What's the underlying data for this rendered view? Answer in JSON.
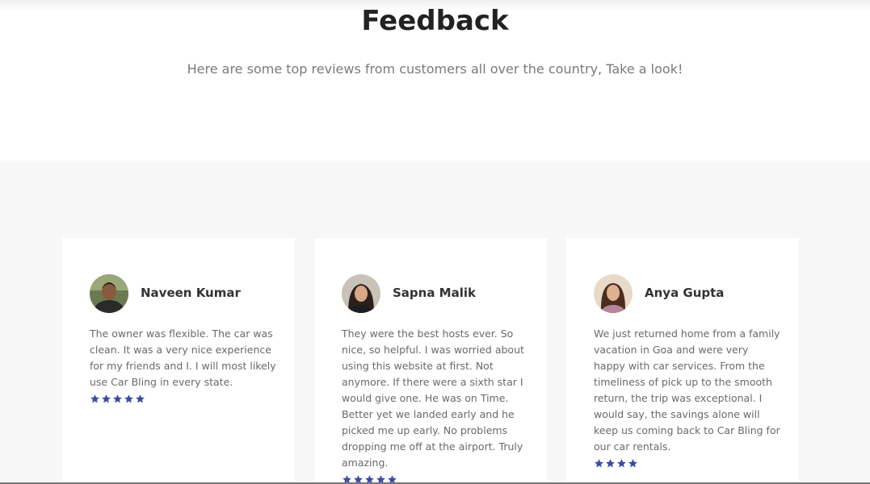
{
  "section": {
    "title": "Feedback",
    "subtitle": "Here are some top reviews from customers all over the country, Take a look!"
  },
  "colors": {
    "star": "#3b4ba8",
    "background_gray": "#f7f7f7"
  },
  "reviews": [
    {
      "name": "Naveen Kumar",
      "text": "The owner was flexible. The car was clean. It was a very nice experience for my friends and I. I will most likely use Car Bling in every state.",
      "rating": 5
    },
    {
      "name": "Sapna Malik",
      "text": "They were the best hosts ever. So nice, so helpful. I was worried about using this website at first. Not anymore. If there were a sixth star I would give one. He was on Time. Better yet we landed early and he picked me up early. No problems dropping me off at the airport. Truly amazing.",
      "rating": 5
    },
    {
      "name": "Anya Gupta",
      "text": "We just returned home from a family vacation in Goa and were very happy with car services. From the timeliness of pick up to the smooth return, the trip was exceptional. I would say, the savings alone will keep us coming back to Car Bling for our car rentals.",
      "rating": 4
    }
  ]
}
